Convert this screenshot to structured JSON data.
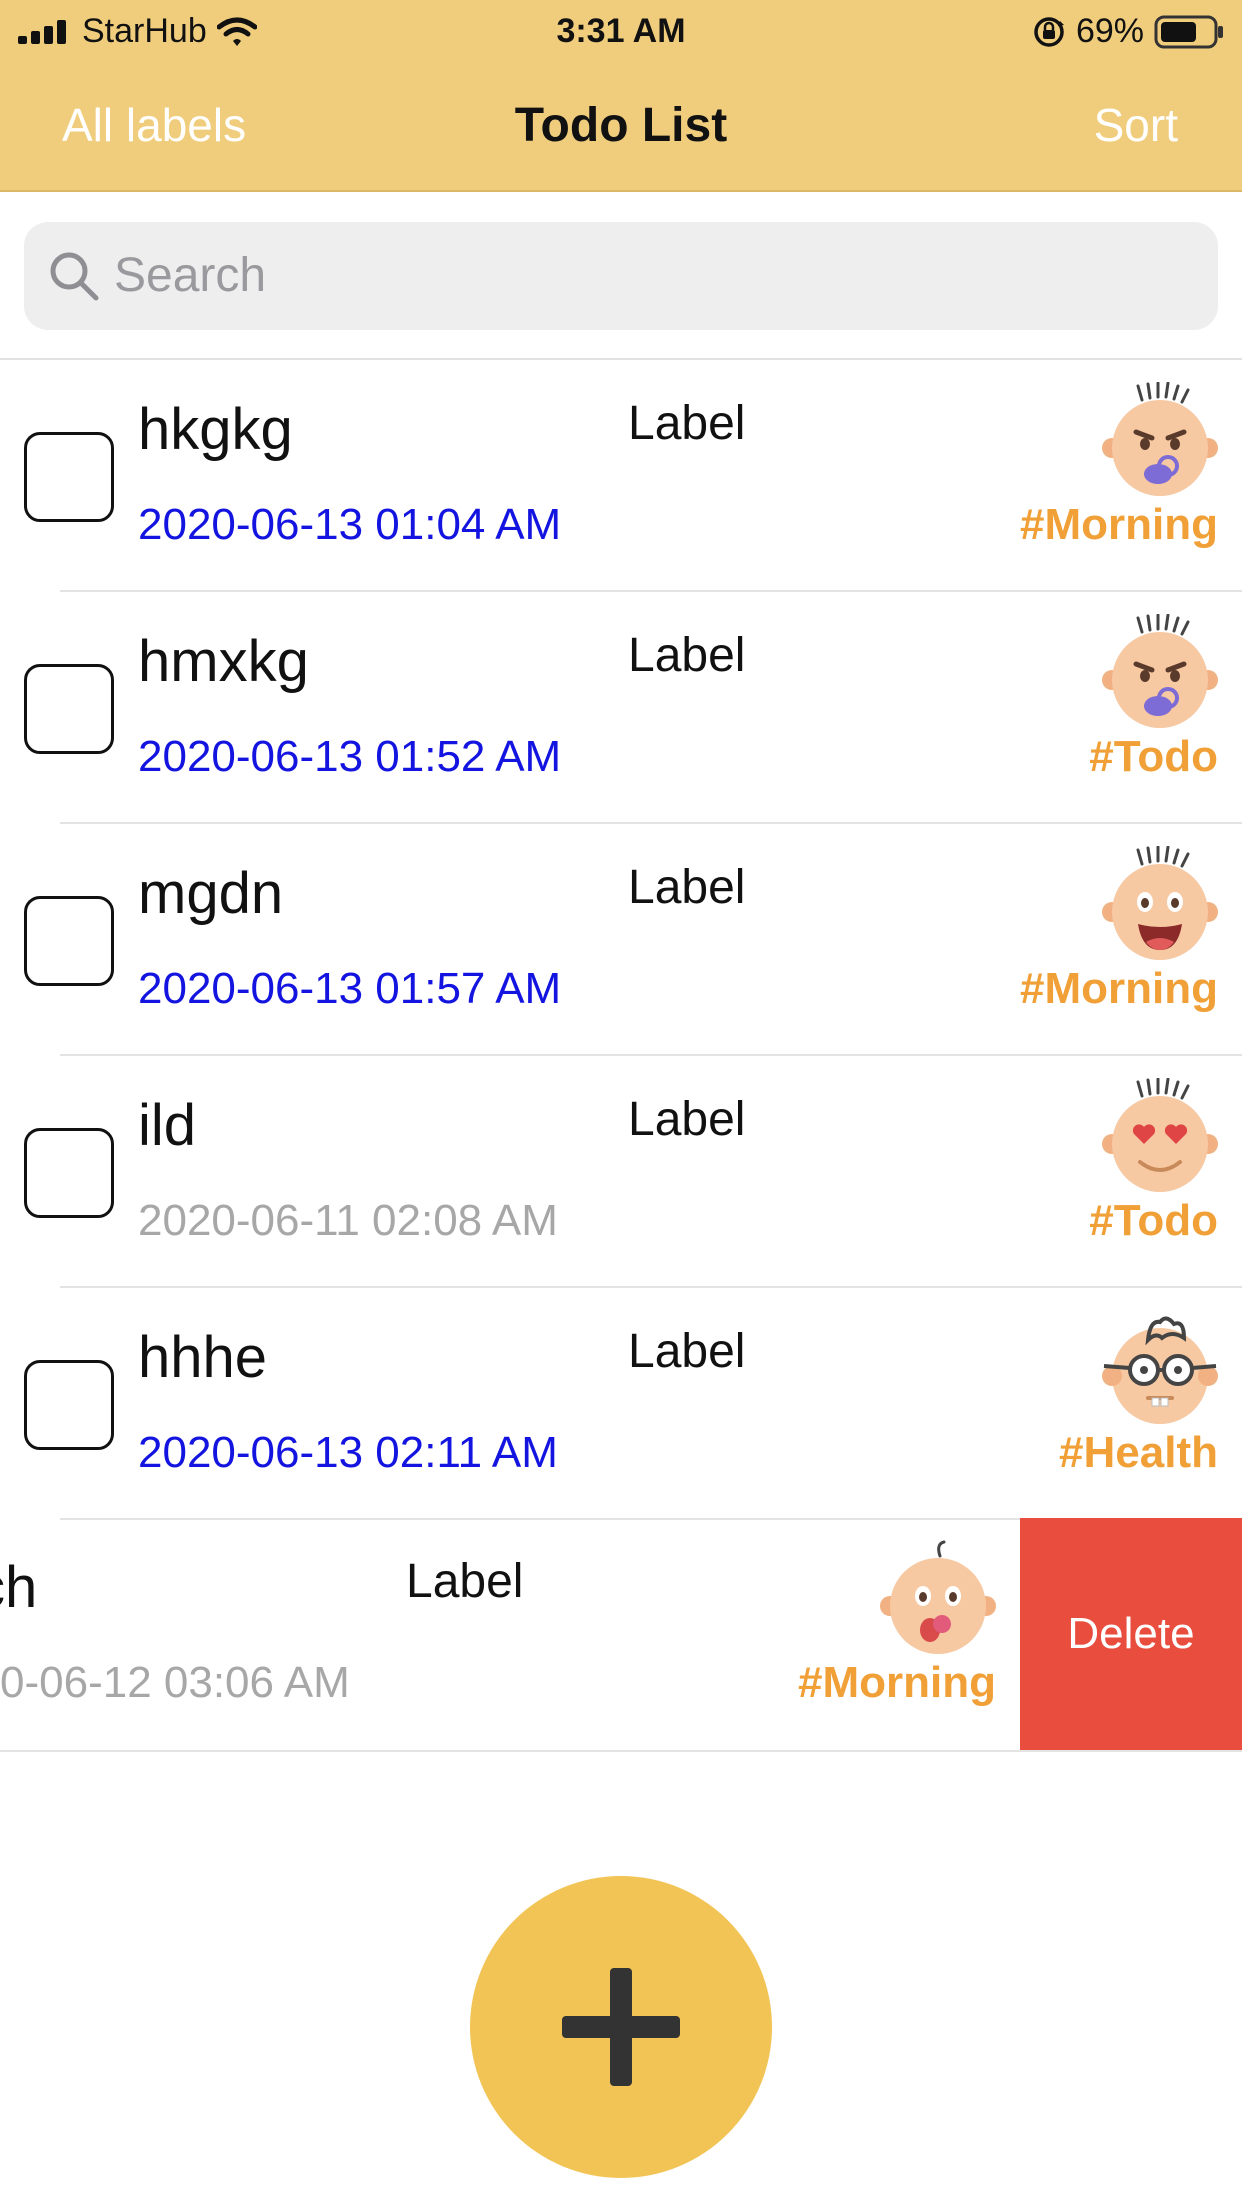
{
  "status_bar": {
    "carrier": "StarHub",
    "time": "3:31 AM",
    "battery": "69%",
    "battery_level": 0.69
  },
  "nav": {
    "left": "All labels",
    "title": "Todo List",
    "right": "Sort"
  },
  "search": {
    "placeholder": "Search",
    "value": ""
  },
  "todos": [
    {
      "title": "hkgkg",
      "date": "2020-06-13 01:04 AM",
      "label": "Label",
      "tag": "#Morning",
      "avatar": "angry-baby-pacifier-icon",
      "overdue": false
    },
    {
      "title": "hmxkg",
      "date": "2020-06-13 01:52 AM",
      "label": "Label",
      "tag": "#Todo",
      "avatar": "angry-baby-pacifier-icon",
      "overdue": false
    },
    {
      "title": "mgdn",
      "date": "2020-06-13 01:57 AM",
      "label": "Label",
      "tag": "#Morning",
      "avatar": "laughing-baby-icon",
      "overdue": false
    },
    {
      "title": "ild",
      "date": "2020-06-11 02:08 AM",
      "label": "Label",
      "tag": "#Todo",
      "avatar": "heart-eyes-baby-icon",
      "overdue": true
    },
    {
      "title": "hhhe",
      "date": "2020-06-13 02:11 AM",
      "label": "Label",
      "tag": "#Health",
      "avatar": "nerd-glasses-icon",
      "overdue": false
    },
    {
      "title": "ch",
      "date": "0-06-12 03:06 AM",
      "label": "Label",
      "tag": "#Morning",
      "avatar": "baby-tongue-icon",
      "overdue": true
    }
  ],
  "swipe_action": {
    "delete_label": "Delete"
  },
  "colors": {
    "header": "#f0cd7d",
    "date_active": "#1414e0",
    "date_past": "#a7a7a7",
    "tag": "#f0a037",
    "delete": "#e94d3e",
    "fab": "#f2c455"
  }
}
